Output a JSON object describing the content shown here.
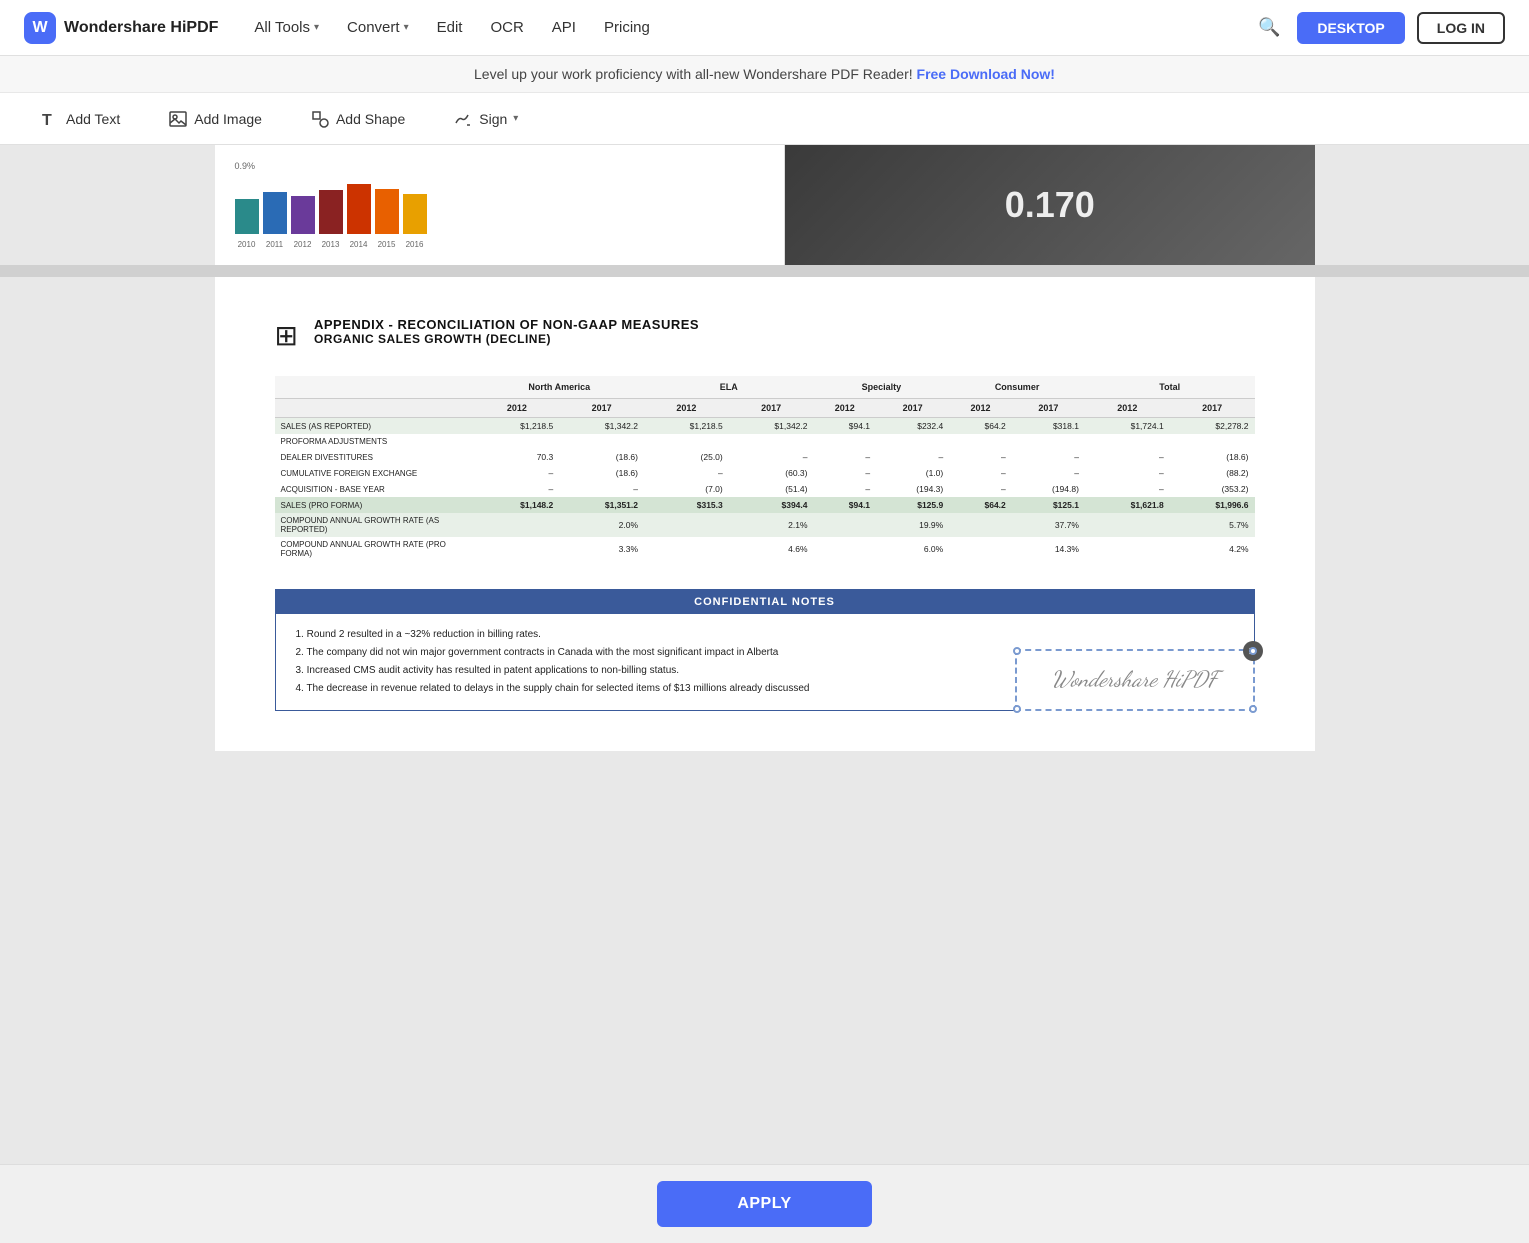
{
  "header": {
    "logo_text": "Wondershare HiPDF",
    "nav": [
      {
        "label": "All Tools",
        "has_dropdown": true
      },
      {
        "label": "Convert",
        "has_dropdown": true
      },
      {
        "label": "Edit",
        "has_dropdown": false
      },
      {
        "label": "OCR",
        "has_dropdown": false
      },
      {
        "label": "API",
        "has_dropdown": false
      },
      {
        "label": "Pricing",
        "has_dropdown": false
      }
    ],
    "btn_desktop": "DESKTOP",
    "btn_login": "LOG IN"
  },
  "promo_banner": {
    "text": "Level up your work proficiency with all-new Wondershare PDF Reader!",
    "link_text": "Free Download Now!"
  },
  "toolbar": {
    "add_text_label": "Add Text",
    "add_image_label": "Add Image",
    "add_shape_label": "Add Shape",
    "sign_label": "Sign"
  },
  "apply_bar": {
    "button_label": "APPLY"
  },
  "appendix": {
    "title1": "APPENDIX - RECONCILIATION OF NON-GAAP MEASURES",
    "title2": "ORGANIC SALES GROWTH (DECLINE)",
    "column_groups": [
      "North America",
      "ELA",
      "Specialty",
      "Consumer",
      "Total"
    ],
    "sub_columns": [
      "2012",
      "2017",
      "2012",
      "2017",
      "2012",
      "2017",
      "2012",
      "2017",
      "2012",
      "2017"
    ],
    "rows": [
      {
        "label": "SALES (AS REPORTED)",
        "values": [
          "$1,218.5",
          "$1,342.2",
          "$1,218.5",
          "$1,342.2",
          "$94.1",
          "$232.4",
          "$64.2",
          "$318.1",
          "$1,724.1",
          "$2,278.2"
        ],
        "style": "highlighted"
      },
      {
        "label": "PROFORMA ADJUSTMENTS",
        "values": [
          "",
          "",
          "",
          "",
          "",
          "",
          "",
          "",
          "",
          ""
        ],
        "style": "normal"
      },
      {
        "label": "DEALER DIVESTITURES",
        "values": [
          "70.3",
          "(18.6)",
          "(25.0)",
          "–",
          "–",
          "–",
          "–",
          "–",
          "–",
          "(18.6)"
        ],
        "style": "normal"
      },
      {
        "label": "CUMULATIVE FOREIGN EXCHANGE",
        "values": [
          "–",
          "(18.6)",
          "–",
          "(60.3)",
          "–",
          "(1.0)",
          "–",
          "–",
          "–",
          "(88.2)"
        ],
        "style": "normal"
      },
      {
        "label": "ACQUISITION - BASE YEAR",
        "values": [
          "–",
          "–",
          "(7.0)",
          "(51.4)",
          "–",
          "(194.3)",
          "–",
          "(194.8)",
          "–",
          "(353.2)"
        ],
        "style": "normal"
      },
      {
        "label": "SALES (PRO FORMA)",
        "values": [
          "$1,148.2",
          "$1,351.2",
          "$315.3",
          "$394.4",
          "$94.1",
          "$125.9",
          "$64.2",
          "$125.1",
          "$1,621.8",
          "$1,996.6"
        ],
        "style": "dark"
      },
      {
        "label": "COMPOUND ANNUAL GROWTH RATE (AS REPORTED)",
        "values": [
          "",
          "2.0%",
          "",
          "2.1%",
          "",
          "19.9%",
          "",
          "37.7%",
          "",
          "5.7%"
        ],
        "style": "highlighted"
      },
      {
        "label": "COMPOUND ANNUAL GROWTH RATE (PRO FORMA)",
        "values": [
          "",
          "3.3%",
          "",
          "4.6%",
          "",
          "6.0%",
          "",
          "14.3%",
          "",
          "4.2%"
        ],
        "style": "normal"
      }
    ]
  },
  "confidential": {
    "header": "CONFIDENTIAL NOTES",
    "notes": [
      "1. Round 2 resulted in a ~32% reduction in billing rates.",
      "2. The company did not win major government contracts in Canada with the most significant impact in Alberta",
      "3. Increased CMS audit activity has resulted in patent applications to non-billing status.",
      "4. The decrease in revenue related to delays in the supply chain for selected items of $13 millions already discussed"
    ]
  },
  "signature": {
    "text": "Wondershare HiPDF"
  },
  "chart": {
    "percent": "0.170"
  }
}
